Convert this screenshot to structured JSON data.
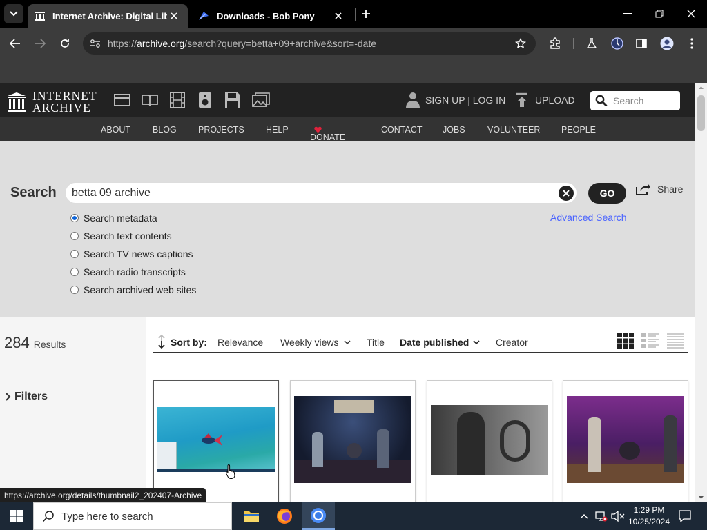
{
  "browser": {
    "tabs": [
      {
        "title": "Internet Archive: Digital Library of Free & Borrowable Books, Movies, Music & Wayback Machine",
        "active": true
      },
      {
        "title": "Downloads - Bob Pony",
        "active": false
      }
    ],
    "url_prefix": "https://",
    "url_domain": "archive.org",
    "url_rest": "/search?query=betta+09+archive&sort=-date",
    "status_url": "https://archive.org/details/thumbnail2_202407-Archive"
  },
  "site": {
    "logo_line1": "INTERNET",
    "logo_line2": "ARCHIVE",
    "signup_label": "SIGN UP | LOG IN",
    "upload_label": "UPLOAD",
    "header_search_placeholder": "Search",
    "nav": [
      "ABOUT",
      "BLOG",
      "PROJECTS",
      "HELP",
      "DONATE",
      "CONTACT",
      "JOBS",
      "VOLUNTEER",
      "PEOPLE"
    ],
    "search": {
      "heading": "Search",
      "query": "betta 09 archive",
      "go_label": "GO",
      "share_label": "Share",
      "advanced_label": "Advanced Search",
      "options": [
        {
          "label": "Search metadata",
          "checked": true
        },
        {
          "label": "Search text contents",
          "checked": false
        },
        {
          "label": "Search TV news captions",
          "checked": false
        },
        {
          "label": "Search radio transcripts",
          "checked": false
        },
        {
          "label": "Search archived web sites",
          "checked": false
        }
      ]
    },
    "results": {
      "count": "284",
      "count_label": "Results",
      "filters_label": "Filters",
      "sort_by_label": "Sort by:",
      "sort_options": [
        "Relevance",
        "Weekly views",
        "Title",
        "Date published",
        "Creator"
      ],
      "active_sort": "Date published"
    }
  },
  "taskbar": {
    "search_placeholder": "Type here to search",
    "time": "1:29 PM",
    "date": "10/25/2024"
  },
  "colors": {
    "ia_header": "#222222",
    "ia_nav": "#333333",
    "accent_link": "#4b64ff",
    "donate_heart": "#e0223c",
    "taskbar": "#1c2836"
  }
}
